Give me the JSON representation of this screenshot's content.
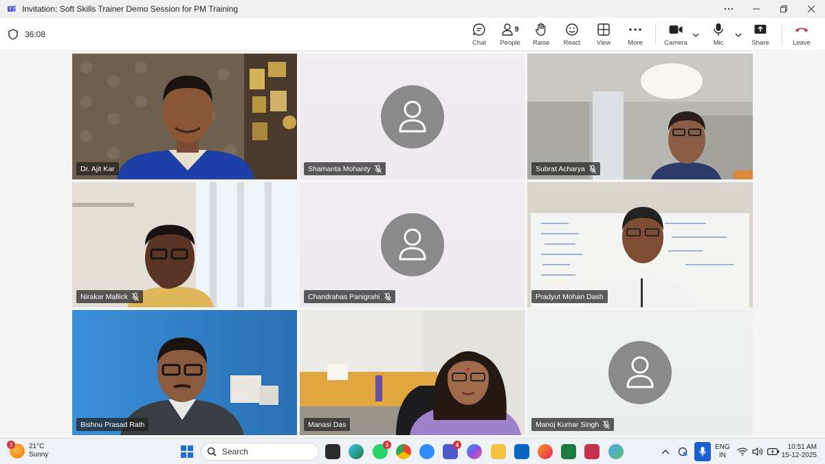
{
  "window": {
    "title": "Invitation: Soft Skills Trainer Demo Session for PM Training",
    "controls": [
      "more-options",
      "minimize",
      "restore",
      "close"
    ]
  },
  "toolbar": {
    "timer": "36:08",
    "chat_label": "Chat",
    "people_label": "People",
    "people_count": "9",
    "raise_label": "Raise",
    "react_label": "React",
    "view_label": "View",
    "more_label": "More",
    "camera_label": "Camera",
    "mic_label": "Mic",
    "share_label": "Share",
    "leave_label": "Leave",
    "leave_color": "#c4314b"
  },
  "participants": [
    {
      "name": "Dr. Ajit Kar",
      "muted": false,
      "video": true,
      "speaking": false
    },
    {
      "name": "Shamanta Mohanty",
      "muted": true,
      "video": false,
      "speaking": false
    },
    {
      "name": "Subrat Acharya",
      "muted": true,
      "video": true,
      "speaking": false
    },
    {
      "name": "Nirakar Mallick",
      "muted": true,
      "video": true,
      "speaking": false
    },
    {
      "name": "Chandrahas Panigrahi",
      "muted": true,
      "video": false,
      "speaking": false
    },
    {
      "name": "Pradyut Mohan Dash",
      "muted": false,
      "video": true,
      "speaking": true
    },
    {
      "name": "Bishnu Prasad Rath",
      "muted": false,
      "video": true,
      "speaking": true
    },
    {
      "name": "Manasi Das",
      "muted": false,
      "video": true,
      "speaking": true
    },
    {
      "name": "Manoj Kumar Singh",
      "muted": true,
      "video": false,
      "speaking": false
    }
  ],
  "taskbar": {
    "weather_temp": "21°C",
    "weather_desc": "Sunny",
    "weather_badge": "3",
    "search_placeholder": "Search",
    "whatsapp_badge": "3",
    "teams_badge": "4",
    "language_line1": "ENG",
    "language_line2": "IN",
    "time": "10:51 AM",
    "date": "15-12-2025"
  },
  "colors": {
    "accent": "#6264a7",
    "avatar_bg": "#8a8a8a"
  }
}
